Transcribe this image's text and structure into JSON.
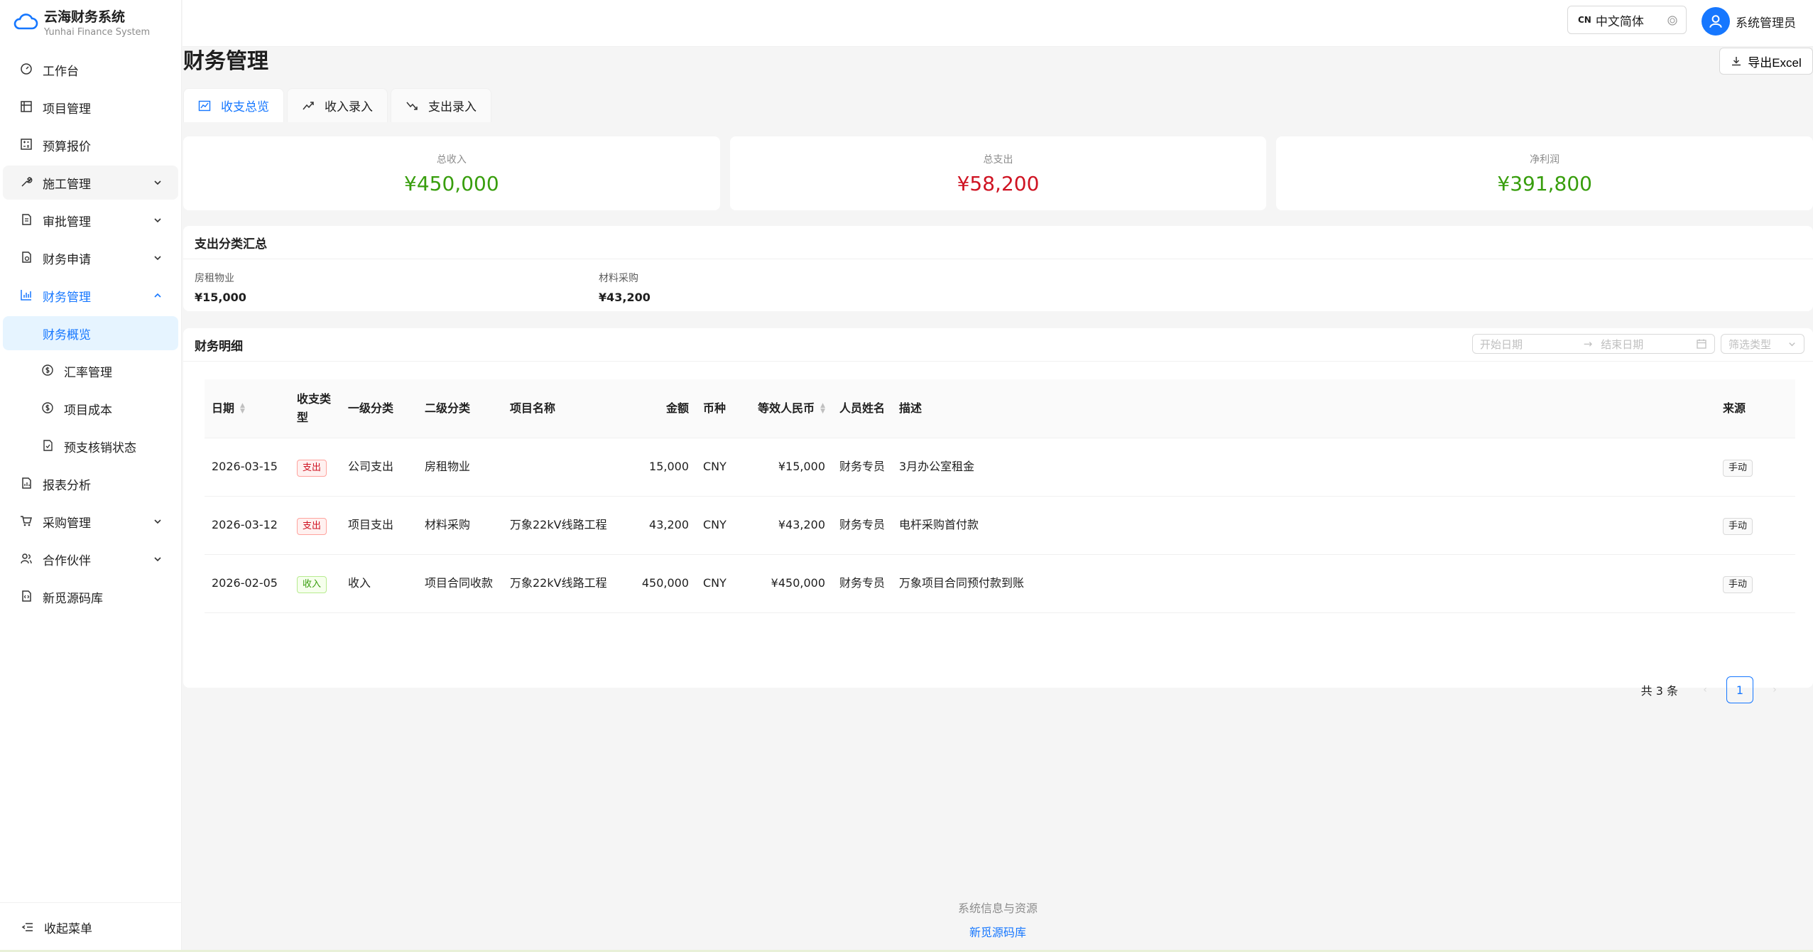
{
  "brand": {
    "title": "云海财务系统",
    "subtitle": "Yunhai Finance System"
  },
  "menu": [
    {
      "label": "工作台",
      "icon": "dashboard-icon"
    },
    {
      "label": "项目管理",
      "icon": "project-icon"
    },
    {
      "label": "预算报价",
      "icon": "calculator-icon"
    },
    {
      "label": "施工管理",
      "icon": "tool-icon",
      "expandable": true
    },
    {
      "label": "审批管理",
      "icon": "audit-icon",
      "expandable": true
    },
    {
      "label": "财务申请",
      "icon": "file-icon",
      "expandable": true
    },
    {
      "label": "财务管理",
      "icon": "bar-chart-icon",
      "expandable": true,
      "open": true
    },
    {
      "label": "财务概览",
      "sub": true,
      "selected": true
    },
    {
      "label": "汇率管理",
      "sub": true,
      "icon": "dollar-icon"
    },
    {
      "label": "项目成本",
      "sub": true,
      "icon": "dollar-icon"
    },
    {
      "label": "预支核销状态",
      "sub": true,
      "icon": "file-check-icon"
    },
    {
      "label": "报表分析",
      "icon": "report-icon"
    },
    {
      "label": "采购管理",
      "icon": "cart-icon",
      "expandable": true
    },
    {
      "label": "合作伙伴",
      "icon": "partner-icon",
      "expandable": true
    },
    {
      "label": "新觅源码库",
      "icon": "code-icon"
    }
  ],
  "collapse_label": "收起菜单",
  "header": {
    "lang_code": "CN",
    "lang_label": "中文简体",
    "user_name": "系统管理员"
  },
  "page": {
    "title": "财务管理",
    "export_label": "导出Excel"
  },
  "tabs": [
    {
      "label": "收支总览",
      "active": true
    },
    {
      "label": "收入录入"
    },
    {
      "label": "支出录入"
    }
  ],
  "stats": [
    {
      "label": "总收入",
      "value": "¥450,000",
      "color": "#389e0d"
    },
    {
      "label": "总支出",
      "value": "¥58,200",
      "color": "#cf1322"
    },
    {
      "label": "净利润",
      "value": "¥391,800",
      "color": "#389e0d"
    }
  ],
  "summary": {
    "title": "支出分类汇总",
    "items": [
      {
        "label": "房租物业",
        "value": "¥15,000"
      },
      {
        "label": "材料采购",
        "value": "¥43,200"
      }
    ]
  },
  "detail": {
    "title": "财务明细",
    "start_placeholder": "开始日期",
    "end_placeholder": "结束日期",
    "type_placeholder": "筛选类型",
    "columns": [
      "日期",
      "收支类型",
      "一级分类",
      "二级分类",
      "项目名称",
      "金额",
      "币种",
      "等效人民币",
      "人员姓名",
      "描述",
      "来源"
    ],
    "rows": [
      {
        "date": "2026-03-15",
        "type": "支出",
        "kind": "out",
        "cat1": "公司支出",
        "cat2": "房租物业",
        "project": "",
        "amount": "15,000",
        "currency": "CNY",
        "cny": "¥15,000",
        "person": "财务专员",
        "desc": "3月办公室租金",
        "source": "手动"
      },
      {
        "date": "2026-03-12",
        "type": "支出",
        "kind": "out",
        "cat1": "项目支出",
        "cat2": "材料采购",
        "project": "万象22kV线路工程",
        "amount": "43,200",
        "currency": "CNY",
        "cny": "¥43,200",
        "person": "财务专员",
        "desc": "电杆采购首付款",
        "source": "手动"
      },
      {
        "date": "2026-02-05",
        "type": "收入",
        "kind": "in",
        "cat1": "收入",
        "cat2": "项目合同收款",
        "project": "万象22kV线路工程",
        "amount": "450,000",
        "currency": "CNY",
        "cny": "¥450,000",
        "person": "财务专员",
        "desc": "万象项目合同预付款到账",
        "source": "手动"
      }
    ],
    "total_label": "共 3 条",
    "current_page": "1"
  },
  "footer": {
    "info": "系统信息与资源",
    "link": "新觅源码库"
  }
}
